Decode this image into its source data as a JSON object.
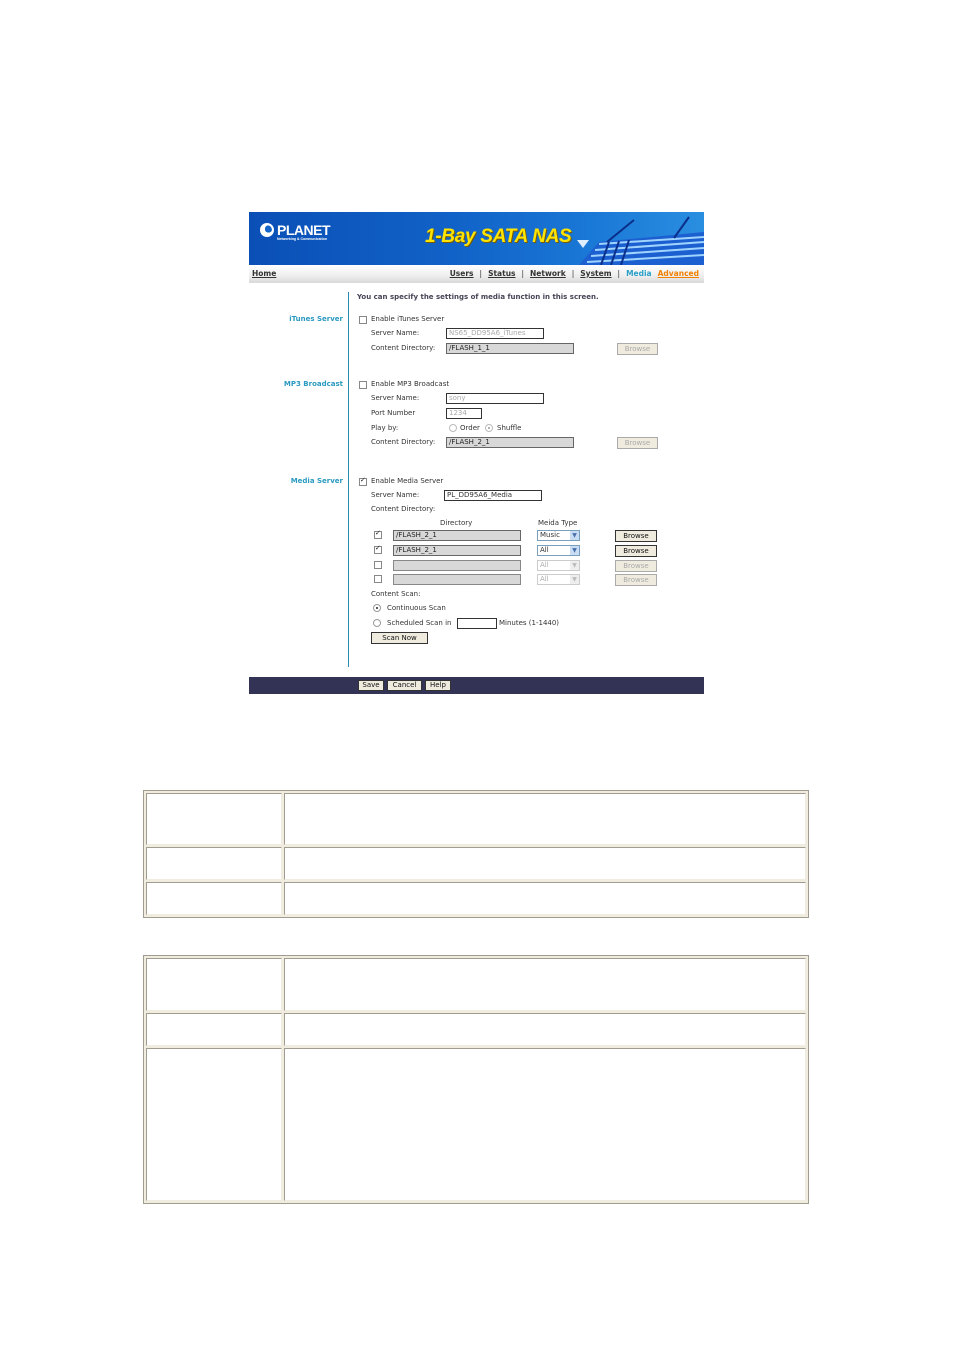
{
  "banner": {
    "logo_name": "PLANET",
    "logo_tagline": "Networking & Communication",
    "product_title": "1-Bay SATA NAS"
  },
  "nav": {
    "home": "Home",
    "items": [
      {
        "label": "Users"
      },
      {
        "label": "Status"
      },
      {
        "label": "Network"
      },
      {
        "label": "System"
      }
    ],
    "separator": "|",
    "active": "Media",
    "advanced": "Advanced",
    "colors": {
      "active": "#2aa0c8",
      "advanced": "#f08000"
    }
  },
  "intro": "You can specify the settings of media function in this screen.",
  "itunes": {
    "section_label": "iTunes Server",
    "enable_label": "Enable iTunes Server",
    "enabled": false,
    "server_name_label": "Server Name:",
    "server_name_value": "NS65_DD95A6_iTunes",
    "content_dir_label": "Content Directory:",
    "content_dir_value": "/FLASH_1_1",
    "browse_label": "Browse"
  },
  "mp3": {
    "section_label": "MP3 Broadcast",
    "enable_label": "Enable MP3 Broadcast",
    "enabled": false,
    "server_name_label": "Server Name:",
    "server_name_value": "sony",
    "port_label": "Port Number",
    "port_value": "1234",
    "play_by_label": "Play by:",
    "play_options": [
      "Order",
      "Shuffle"
    ],
    "play_selected": "Shuffle",
    "content_dir_label": "Content Directory:",
    "content_dir_value": "/FLASH_2_1",
    "browse_label": "Browse"
  },
  "media": {
    "section_label": "Media Server",
    "enable_label": "Enable Media Server",
    "enabled": true,
    "server_name_label": "Server Name:",
    "server_name_value": "PL_DD95A6_Media",
    "content_dir_label": "Content Directory:",
    "col_directory": "Directory",
    "col_media_type": "Meida Type",
    "rows": [
      {
        "checked": true,
        "directory": "/FLASH_2_1",
        "type": "Music",
        "browse": "Browse"
      },
      {
        "checked": true,
        "directory": "/FLASH_2_1",
        "type": "All",
        "browse": "Browse"
      },
      {
        "checked": false,
        "directory": "",
        "type": "All",
        "browse": "Browse"
      },
      {
        "checked": false,
        "directory": "",
        "type": "All",
        "browse": "Browse"
      }
    ],
    "content_scan_label": "Content Scan:",
    "continuous_label": "Continuous Scan",
    "scheduled_label": "Scheduled Scan in",
    "scheduled_value": "",
    "minutes_label": "Minutes (1-1440)",
    "scan_selected": "Continuous Scan",
    "scan_now_label": "Scan Now"
  },
  "footer": {
    "save": "Save",
    "cancel": "Cancel",
    "help": "Help"
  },
  "tables": [
    {
      "rows": [
        [
          "",
          ""
        ],
        [
          "",
          ""
        ],
        [
          "",
          ""
        ]
      ]
    },
    {
      "rows": [
        [
          "",
          ""
        ],
        [
          "",
          ""
        ],
        [
          "",
          ""
        ]
      ]
    }
  ]
}
